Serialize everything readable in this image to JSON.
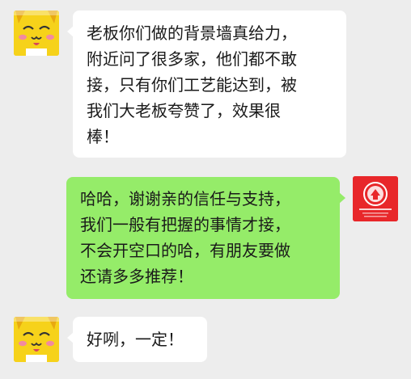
{
  "chat": {
    "messages": [
      {
        "sender": "contact",
        "text": "老板你们做的背景墙真给力，\n附近问了很多家，他们都不敢\n接，只有你们工艺能达到，被\n我们大老板夸赞了，效果很\n棒！"
      },
      {
        "sender": "me",
        "text": "哈哈，谢谢亲的信任与支持，\n我们一般有把握的事情才接，\n不会开空口的哈，有朋友要做\n还请多多推荐！"
      },
      {
        "sender": "contact",
        "text": "好咧，一定！"
      }
    ]
  },
  "colors": {
    "background": "#ededed",
    "incoming_bubble": "#ffffff",
    "outgoing_bubble": "#95ec69",
    "cat_avatar": "#f6d21a",
    "shop_avatar": "#e8272a"
  },
  "icons": {
    "contact_avatar": "yellow-cat-avatar-icon",
    "my_avatar": "red-shop-logo-avatar-icon"
  }
}
